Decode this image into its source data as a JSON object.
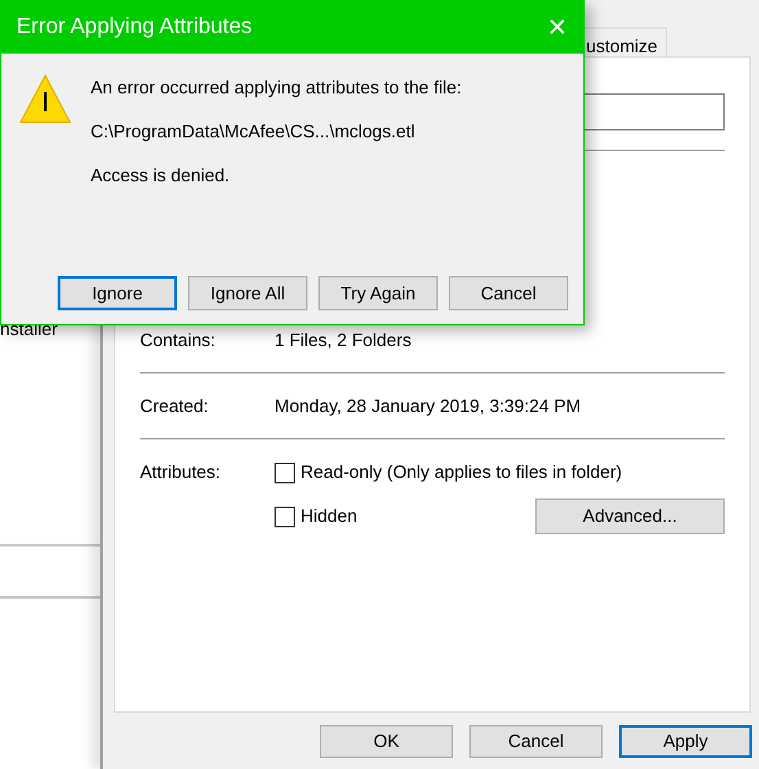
{
  "background_window": {
    "text": "nstaller"
  },
  "properties_dialog": {
    "tabs": [
      {
        "label": "ustomize",
        "selected": false
      }
    ],
    "details": [
      {
        "label": "Contains:",
        "value": "1 Files, 2 Folders"
      },
      {
        "label": "Created:",
        "value": "Monday, 28 January 2019, 3:39:24 PM"
      }
    ],
    "attributes": {
      "label": "Attributes:",
      "checkboxes": [
        {
          "label": "Read-only (Only applies to files in folder)",
          "checked": false
        },
        {
          "label": "Hidden",
          "checked": false
        }
      ],
      "advanced_button": "Advanced..."
    },
    "buttons": [
      {
        "label": "OK",
        "focused": false
      },
      {
        "label": "Cancel",
        "focused": false
      },
      {
        "label": "Apply",
        "focused": true
      }
    ]
  },
  "error_dialog": {
    "title": "Error Applying Attributes",
    "close": "✕",
    "messages": [
      "An error occurred applying attributes to the file:",
      "C:\\ProgramData\\McAfee\\CS...\\mclogs.etl",
      "Access is denied."
    ],
    "buttons": [
      {
        "label": "Ignore",
        "focused": true
      },
      {
        "label": "Ignore All",
        "focused": false
      },
      {
        "label": "Try Again",
        "focused": false
      },
      {
        "label": "Cancel",
        "focused": false
      }
    ]
  }
}
